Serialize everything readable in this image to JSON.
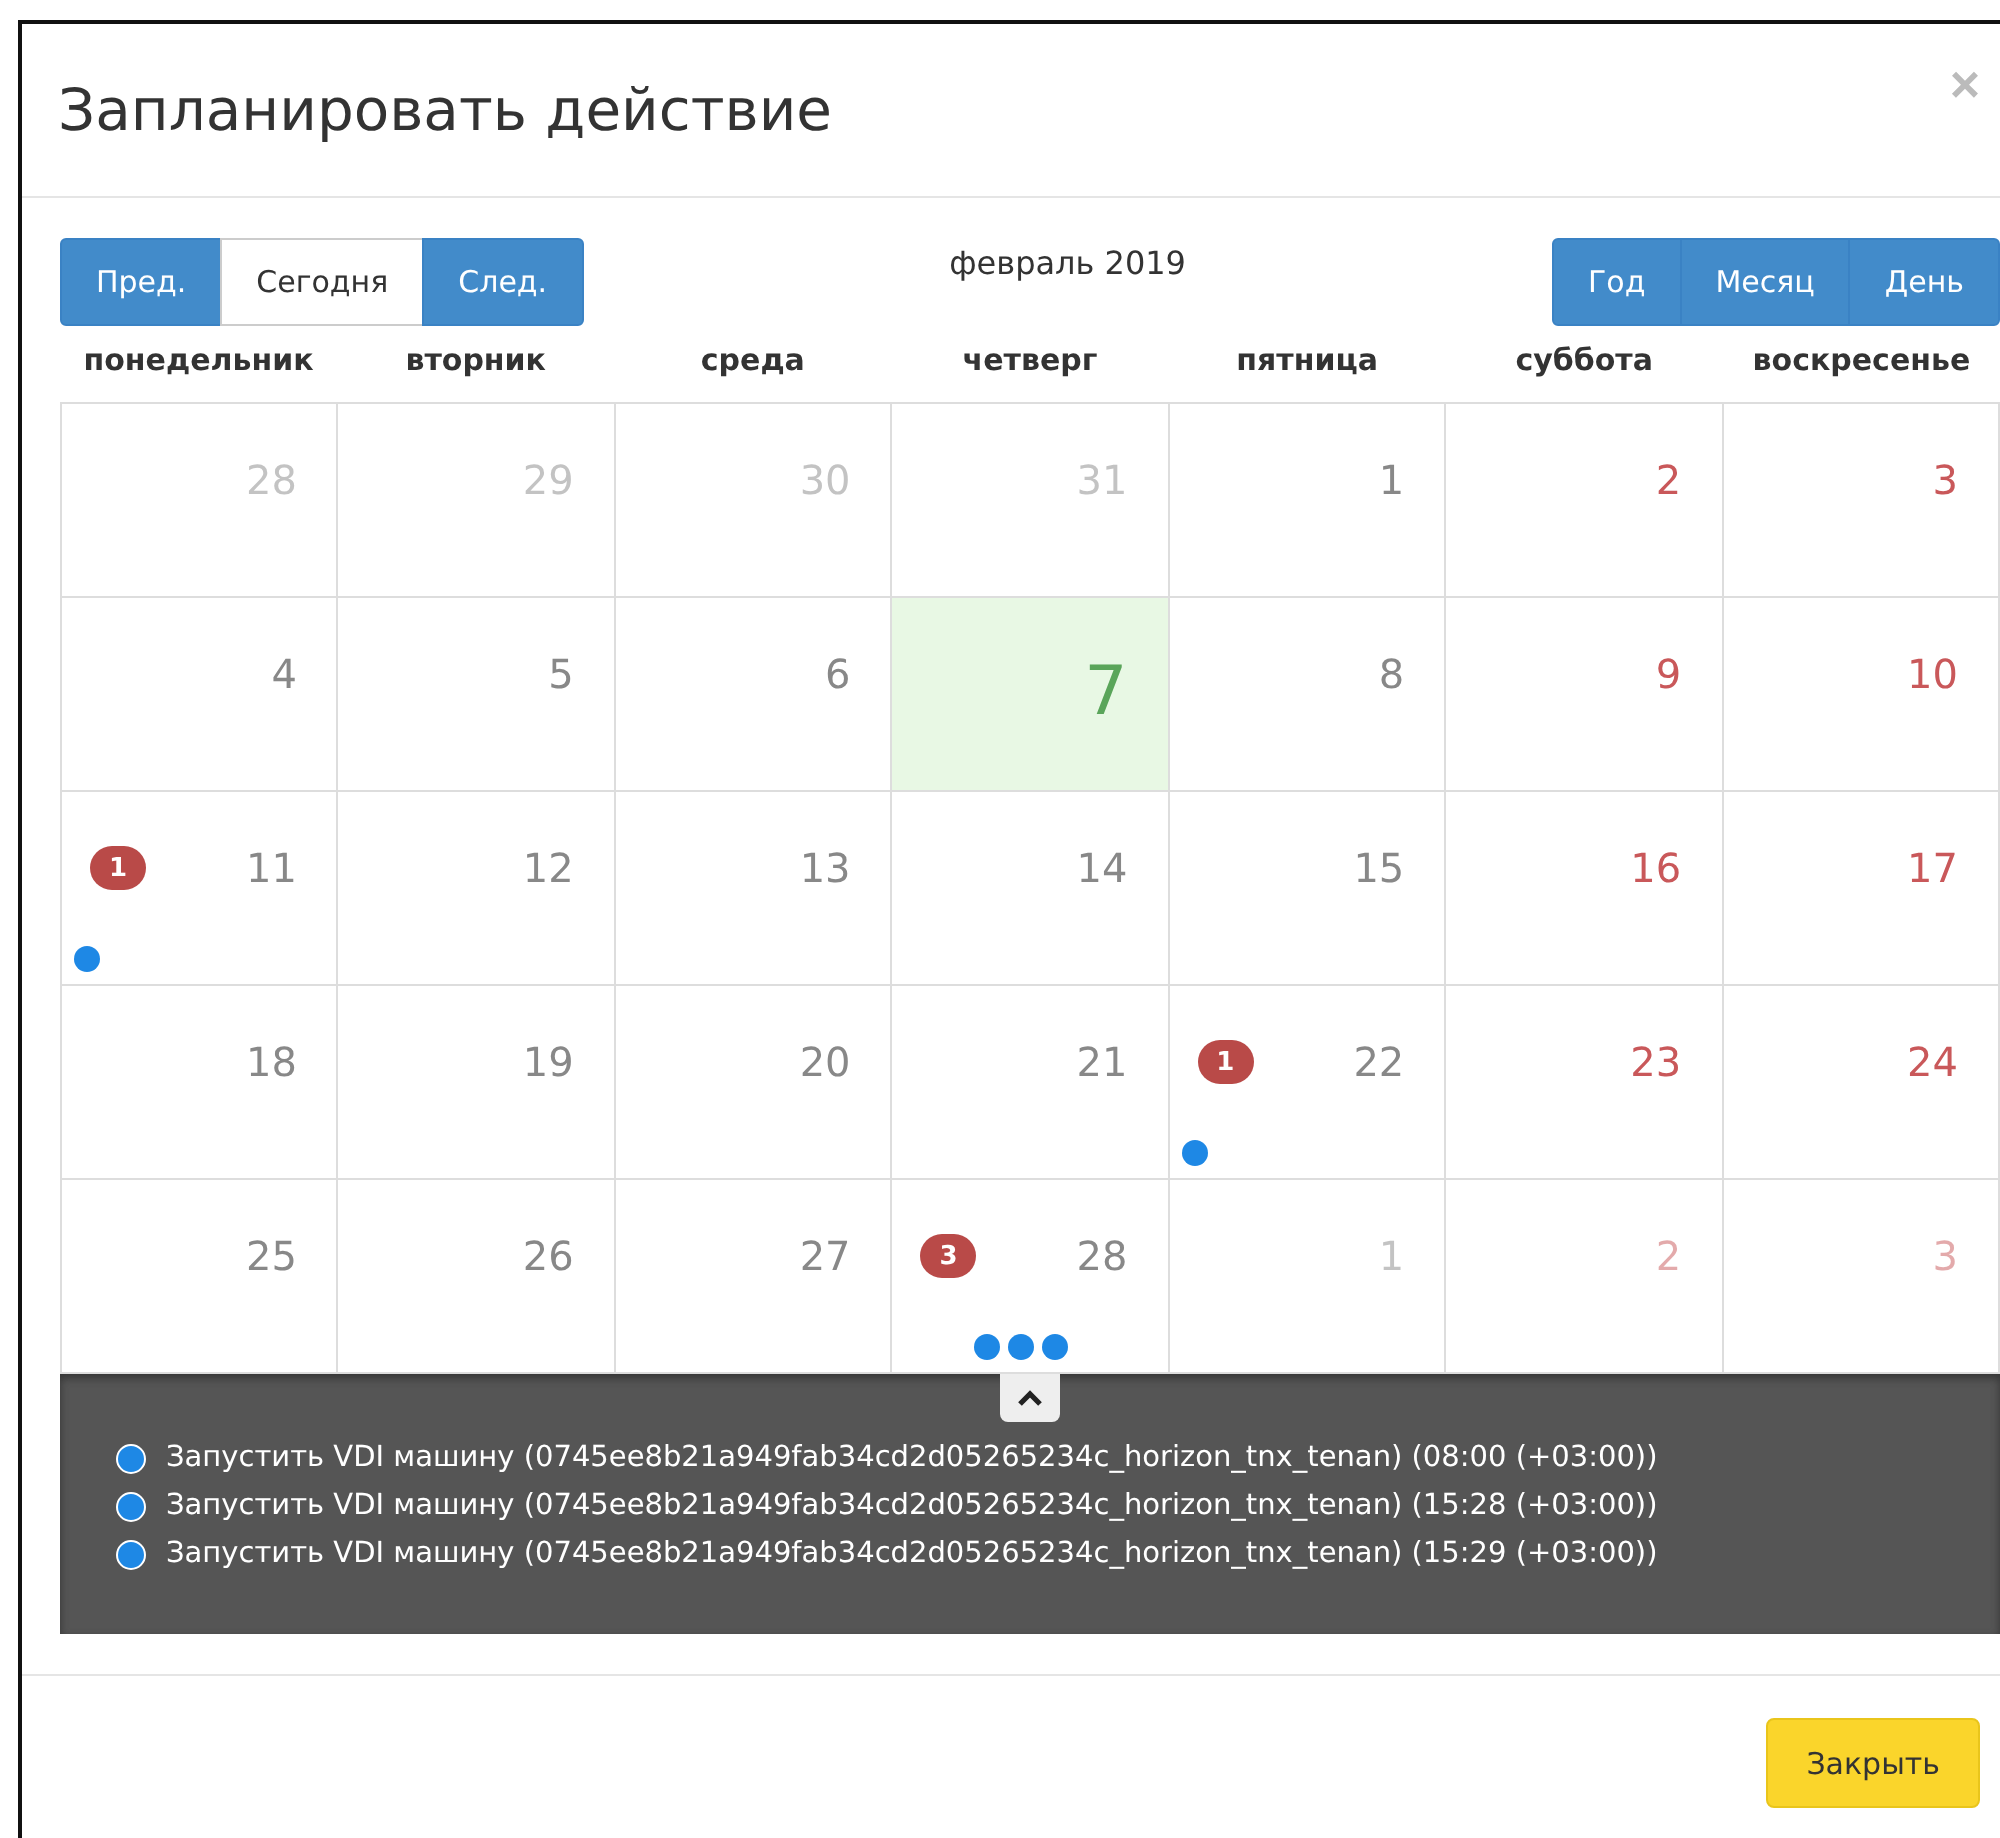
{
  "dialog": {
    "title": "Запланировать действие",
    "close": "×"
  },
  "toolbar": {
    "nav": [
      {
        "label": "Пред.",
        "selected": false
      },
      {
        "label": "Сегодня",
        "selected": true
      },
      {
        "label": "След.",
        "selected": false
      }
    ],
    "month": "февраль 2019",
    "views": [
      {
        "label": "Год",
        "selected": false
      },
      {
        "label": "Месяц",
        "selected": false
      },
      {
        "label": "День",
        "selected": false
      }
    ]
  },
  "weekdays": [
    "понедельник",
    "вторник",
    "среда",
    "четверг",
    "пятница",
    "суббота",
    "воскресенье"
  ],
  "weeks": [
    [
      {
        "number": "28",
        "other_month": true,
        "weekend": false,
        "today": false
      },
      {
        "number": "29",
        "other_month": true,
        "weekend": false,
        "today": false
      },
      {
        "number": "30",
        "other_month": true,
        "weekend": false,
        "today": false
      },
      {
        "number": "31",
        "other_month": true,
        "weekend": false,
        "today": false
      },
      {
        "number": "1",
        "other_month": false,
        "weekend": false,
        "today": false
      },
      {
        "number": "2",
        "other_month": false,
        "weekend": true,
        "today": false
      },
      {
        "number": "3",
        "other_month": false,
        "weekend": true,
        "today": false
      }
    ],
    [
      {
        "number": "4",
        "other_month": false,
        "weekend": false,
        "today": false
      },
      {
        "number": "5",
        "other_month": false,
        "weekend": false,
        "today": false
      },
      {
        "number": "6",
        "other_month": false,
        "weekend": false,
        "today": false
      },
      {
        "number": "7",
        "other_month": false,
        "weekend": false,
        "today": true
      },
      {
        "number": "8",
        "other_month": false,
        "weekend": false,
        "today": false
      },
      {
        "number": "9",
        "other_month": false,
        "weekend": true,
        "today": false
      },
      {
        "number": "10",
        "other_month": false,
        "weekend": true,
        "today": false
      }
    ],
    [
      {
        "number": "11",
        "other_month": false,
        "weekend": false,
        "today": false,
        "badge": "1",
        "dots": [
          {
            "kind": "event"
          }
        ]
      },
      {
        "number": "12",
        "other_month": false,
        "weekend": false,
        "today": false
      },
      {
        "number": "13",
        "other_month": false,
        "weekend": false,
        "today": false
      },
      {
        "number": "14",
        "other_month": false,
        "weekend": false,
        "today": false
      },
      {
        "number": "15",
        "other_month": false,
        "weekend": false,
        "today": false
      },
      {
        "number": "16",
        "other_month": false,
        "weekend": true,
        "today": false
      },
      {
        "number": "17",
        "other_month": false,
        "weekend": true,
        "today": false
      }
    ],
    [
      {
        "number": "18",
        "other_month": false,
        "weekend": false,
        "today": false
      },
      {
        "number": "19",
        "other_month": false,
        "weekend": false,
        "today": false
      },
      {
        "number": "20",
        "other_month": false,
        "weekend": false,
        "today": false
      },
      {
        "number": "21",
        "other_month": false,
        "weekend": false,
        "today": false
      },
      {
        "number": "22",
        "other_month": false,
        "weekend": false,
        "today": false,
        "badge": "1",
        "dots": [
          {
            "kind": "event"
          }
        ]
      },
      {
        "number": "23",
        "other_month": false,
        "weekend": true,
        "today": false
      },
      {
        "number": "24",
        "other_month": false,
        "weekend": true,
        "today": false
      }
    ],
    [
      {
        "number": "25",
        "other_month": false,
        "weekend": false,
        "today": false
      },
      {
        "number": "26",
        "other_month": false,
        "weekend": false,
        "today": false
      },
      {
        "number": "27",
        "other_month": false,
        "weekend": false,
        "today": false
      },
      {
        "number": "28",
        "other_month": false,
        "weekend": false,
        "today": false,
        "badge": "3",
        "dots": [
          {
            "kind": "event"
          },
          {
            "kind": "event"
          },
          {
            "kind": "event"
          }
        ]
      },
      {
        "number": "1",
        "other_month": true,
        "weekend": false,
        "today": false
      },
      {
        "number": "2",
        "other_month": true,
        "weekend": true,
        "today": false
      },
      {
        "number": "3",
        "other_month": true,
        "weekend": true,
        "today": false
      }
    ]
  ],
  "events_panel": {
    "expanded": true,
    "events": [
      {
        "kind": "event",
        "text": "Запустить VDI машину (0745ee8b21a949fab34cd2d05265234c_horizon_tnx_tenan) (08:00 (+03:00))"
      },
      {
        "kind": "event",
        "text": "Запустить VDI машину (0745ee8b21a949fab34cd2d05265234c_horizon_tnx_tenan) (15:28 (+03:00))"
      },
      {
        "kind": "event",
        "text": "Запустить VDI машину (0745ee8b21a949fab34cd2d05265234c_horizon_tnx_tenan) (15:29 (+03:00))"
      }
    ]
  },
  "footer": {
    "buttons": [
      "Закрыть"
    ]
  }
}
